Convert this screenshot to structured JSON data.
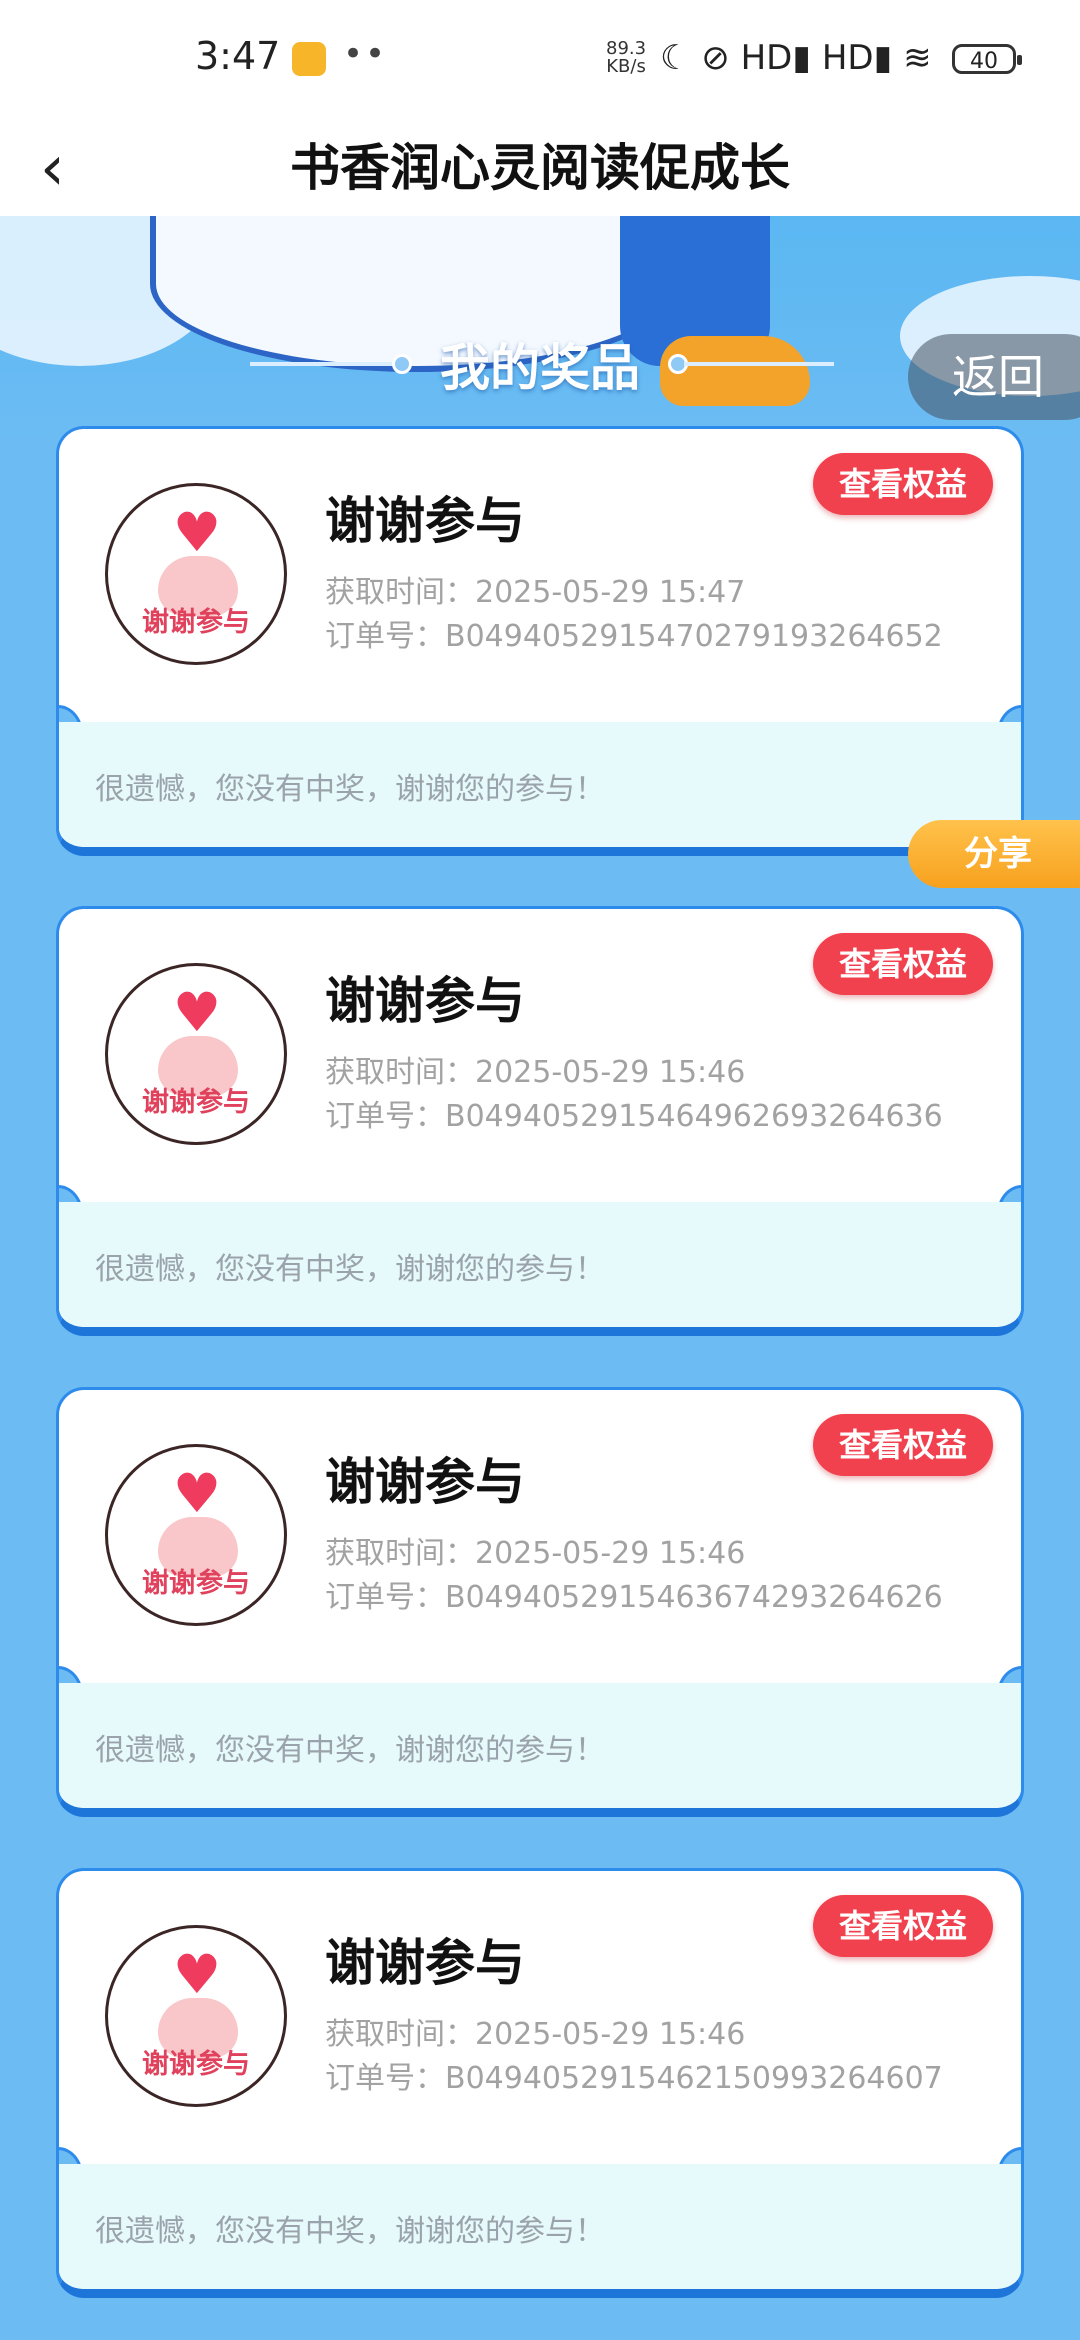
{
  "status_bar": {
    "time": "3:47",
    "dots": "••",
    "network_speed": "89.3",
    "network_unit": "KB/s",
    "icons": "☾ ⊘ HD▮ HD▮ ≋",
    "battery": "40"
  },
  "header": {
    "back_icon": "‹",
    "title": "书香润心灵阅读促成长"
  },
  "banner": {
    "title": "我的奖品",
    "return_label": "返回"
  },
  "share_label": "分享",
  "avatar_text": "谢谢参与",
  "cards": [
    {
      "name": "谢谢参与",
      "time": "获取时间：2025-05-29 15:47",
      "order": "订单号：B0494052915470279193264652",
      "button": "查看权益",
      "footer": "很遗憾，您没有中奖，谢谢您的参与！"
    },
    {
      "name": "谢谢参与",
      "time": "获取时间：2025-05-29 15:46",
      "order": "订单号：B0494052915464962693264636",
      "button": "查看权益",
      "footer": "很遗憾，您没有中奖，谢谢您的参与！"
    },
    {
      "name": "谢谢参与",
      "time": "获取时间：2025-05-29 15:46",
      "order": "订单号：B0494052915463674293264626",
      "button": "查看权益",
      "footer": "很遗憾，您没有中奖，谢谢您的参与！"
    },
    {
      "name": "谢谢参与",
      "time": "获取时间：2025-05-29 15:46",
      "order": "订单号：B0494052915462150993264607",
      "button": "查看权益",
      "footer": "很遗憾，您没有中奖，谢谢您的参与！"
    }
  ]
}
